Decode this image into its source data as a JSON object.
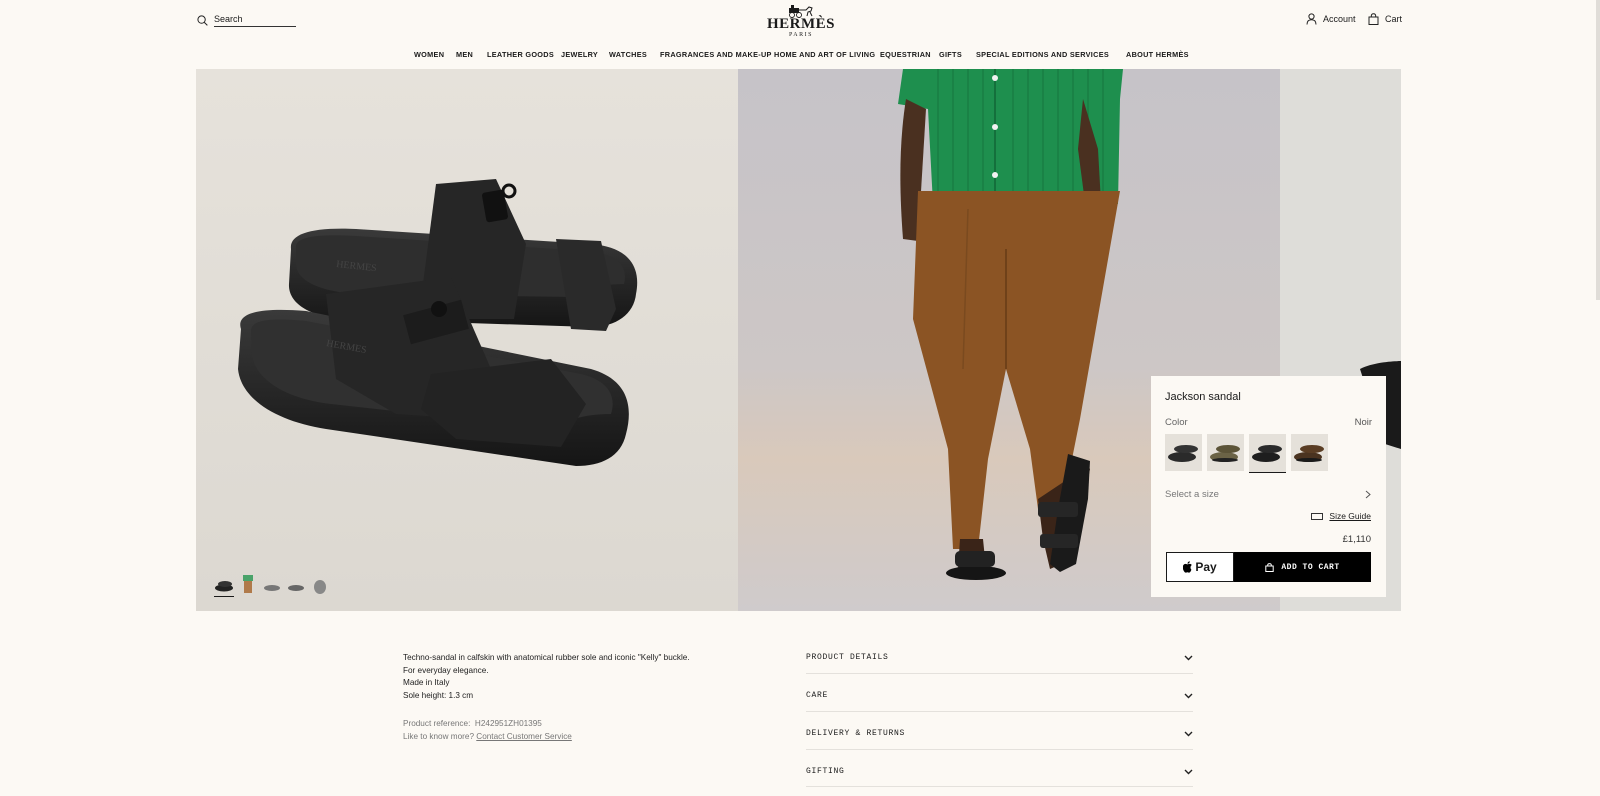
{
  "header": {
    "search_placeholder": "Search",
    "logo_brand": "HERMÈS",
    "logo_city": "PARIS",
    "account_label": "Account",
    "cart_label": "Cart"
  },
  "nav": {
    "items": [
      "WOMEN",
      "MEN",
      "LEATHER GOODS",
      "JEWELRY",
      "WATCHES",
      "FRAGRANCES AND MAKE-UP",
      "HOME AND ART OF LIVING",
      "EQUESTRIAN",
      "GIFTS",
      "SPECIAL EDITIONS AND SERVICES",
      "ABOUT HERMÈS"
    ]
  },
  "gallery": {
    "active_thumb": 0,
    "thumb_count": 5
  },
  "product": {
    "name": "Jackson sandal",
    "color_label": "Color",
    "color_value": "Noir",
    "swatches": [
      {
        "name": "noir-sandal-swatch",
        "color": "#2a2a2a"
      },
      {
        "name": "olive-sandal-swatch",
        "color": "#6b6346"
      },
      {
        "name": "black-sandal-swatch",
        "color": "#1e1e1e"
      },
      {
        "name": "brown-sandal-swatch",
        "color": "#4a3320"
      }
    ],
    "selected_swatch": 2,
    "size_label": "Select a size",
    "size_guide_label": "Size Guide",
    "price": "£1,110",
    "pay_label": "Pay",
    "add_to_cart_label": "ADD TO CART"
  },
  "description": {
    "lines": [
      "Techno-sandal in calfskin with anatomical rubber sole and iconic \"Kelly\" buckle.",
      "For everyday elegance.",
      "Made in Italy",
      "Sole height: 1.3 cm"
    ],
    "reference_label": "Product reference:",
    "reference_value": "H242951ZH01395",
    "help_label": "Like to know more?",
    "help_link": "Contact Customer Service"
  },
  "accordion": {
    "items": [
      "PRODUCT DETAILS",
      "CARE",
      "DELIVERY & RETURNS",
      "GIFTING"
    ]
  },
  "colors": {
    "background": "#fcf9f4",
    "accent": "#000000",
    "shirt": "#1e8f4e",
    "trousers": "#8b5424"
  }
}
